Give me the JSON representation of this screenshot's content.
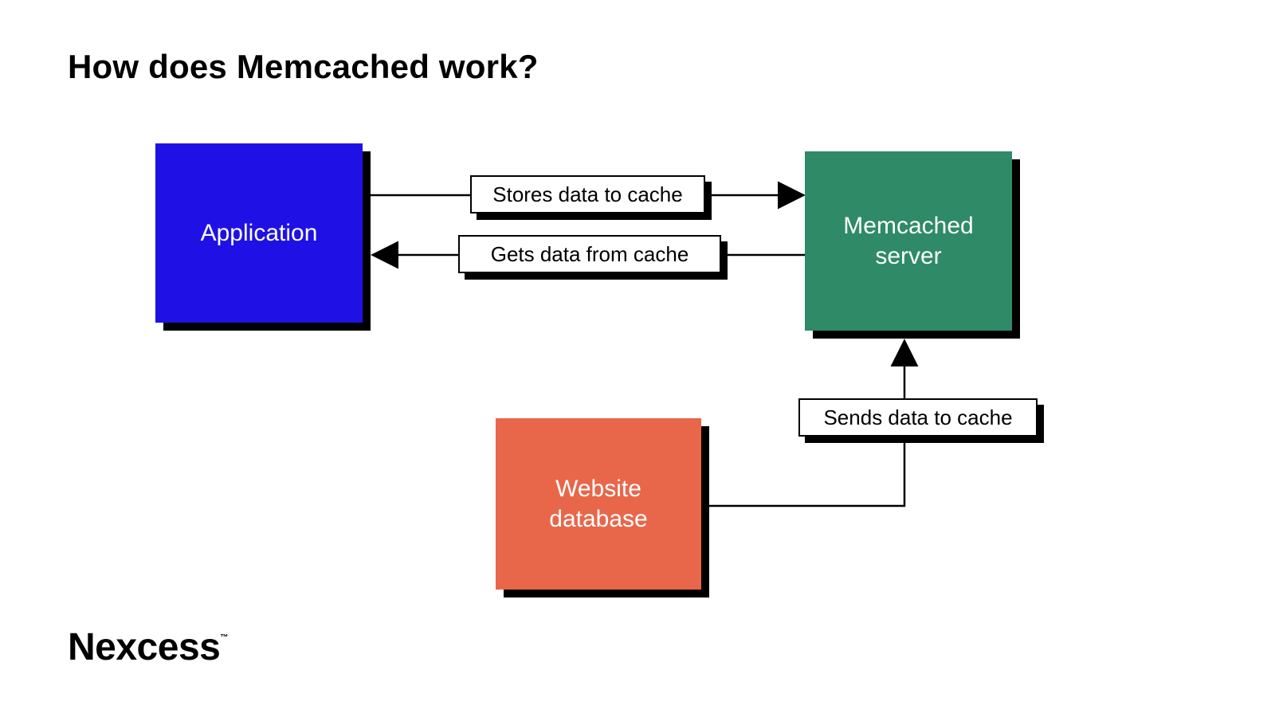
{
  "title": "How does Memcached work?",
  "brand": "Nexcess",
  "nodes": {
    "application": {
      "label": "Application",
      "color": "#1F11E5"
    },
    "memcached": {
      "label": "Memcached\nserver",
      "color": "#2E8A67"
    },
    "database": {
      "label": "Website\ndatabase",
      "color": "#E8674A"
    }
  },
  "edges": {
    "app_to_mem": {
      "from": "application",
      "to": "memcached",
      "label": "Stores data to cache"
    },
    "mem_to_app": {
      "from": "memcached",
      "to": "application",
      "label": "Gets data from cache"
    },
    "db_to_mem": {
      "from": "database",
      "to": "memcached",
      "label": "Sends data to cache"
    }
  }
}
